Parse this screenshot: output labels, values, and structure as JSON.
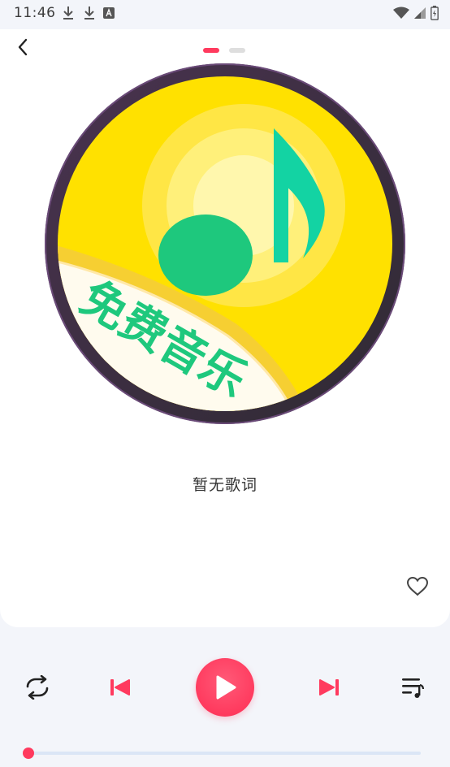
{
  "status_bar": {
    "time": "11:46",
    "left_icons": [
      "download-icon",
      "download-icon",
      "text-badge-icon"
    ],
    "right_icons": [
      "wifi-icon",
      "signal-icon",
      "battery-icon"
    ]
  },
  "header": {
    "back_icon": "chevron-left-icon",
    "page_indicator": {
      "count": 2,
      "active_index": 0
    }
  },
  "album_art": {
    "label": "免费音乐",
    "icon": "music-note-icon",
    "colors": {
      "yellow": "#ffe100",
      "green": "#1ec87d",
      "ring": "#3a2a44"
    }
  },
  "lyrics": {
    "text": "暂无歌词"
  },
  "favorite": {
    "icon": "heart-outline-icon",
    "is_favorite": false
  },
  "controls": {
    "repeat_icon": "repeat-icon",
    "previous_icon": "skip-previous-icon",
    "play_icon": "play-icon",
    "next_icon": "skip-next-icon",
    "playlist_icon": "playlist-icon"
  },
  "progress": {
    "fraction": 0.0
  },
  "theme": {
    "accent": "#ff3a5e",
    "background": "#f3f5fa",
    "track": "#dbe6f6"
  }
}
